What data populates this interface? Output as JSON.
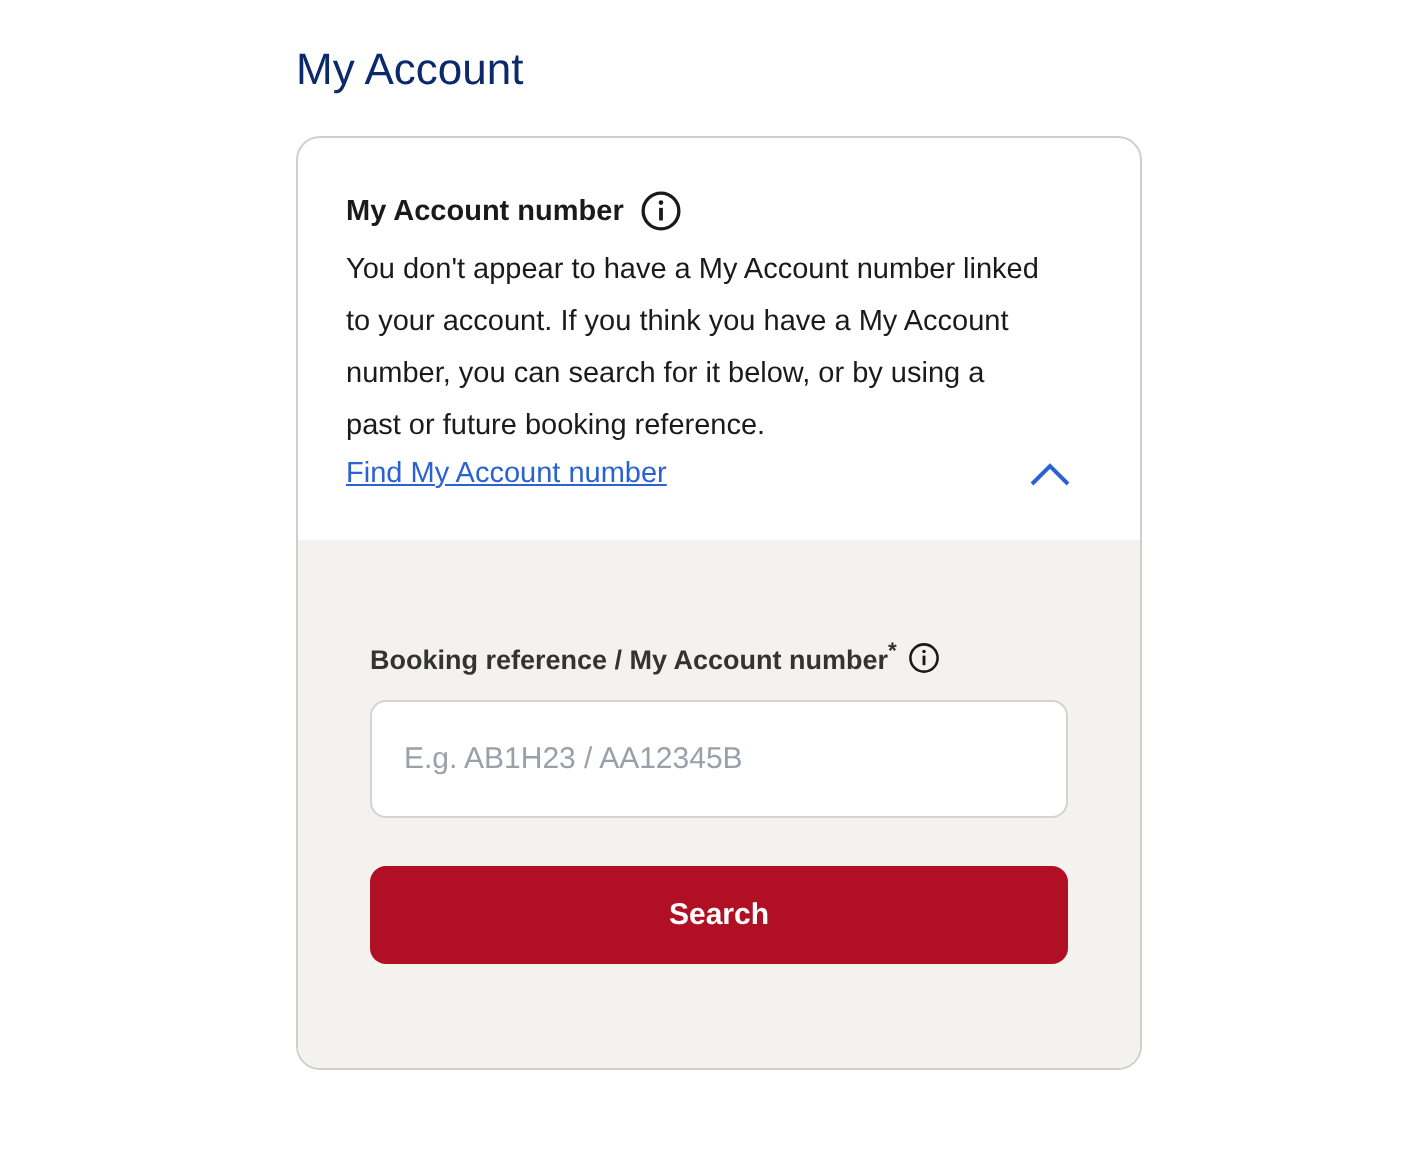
{
  "page_title": "My Account",
  "card": {
    "heading": "My Account number",
    "body": "You don't appear to have a My Account number linked to your account. If you think you have a My Account number, you can search for it below, or by using a past or future booking reference.",
    "link": "Find My Account number",
    "expanded": true,
    "form": {
      "label": "Booking reference / My Account number$^{*}$",
      "placeholder": "E.g. AB1H23 / AA12345B",
      "button": "Search"
    }
  }
}
